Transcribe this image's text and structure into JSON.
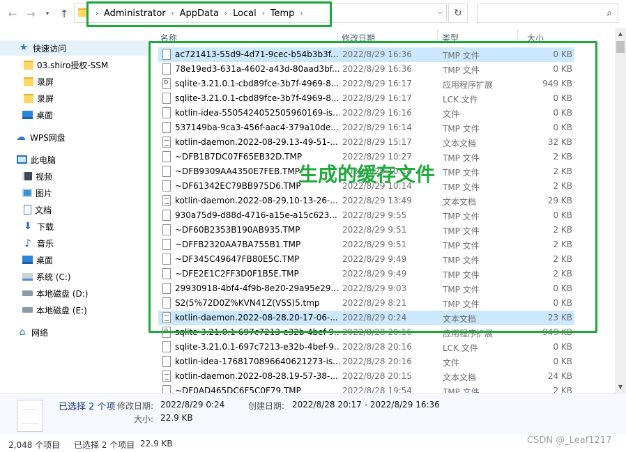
{
  "address": {
    "crumbs": [
      "Administrator",
      "AppData",
      "Local",
      "Temp"
    ]
  },
  "nav": {
    "back_icon": "back-arrow-icon",
    "forward_icon": "forward-arrow-icon",
    "history_icon": "chevron-down-icon",
    "up_icon": "up-arrow-icon"
  },
  "sidebar": {
    "items": [
      {
        "label": "快速访问",
        "icon": "star-icon"
      },
      {
        "label": "03.shiro授权-SSM",
        "icon": "folder-icon"
      },
      {
        "label": "录屏",
        "icon": "folder-icon"
      },
      {
        "label": "录屏",
        "icon": "folder-icon"
      },
      {
        "label": "桌面",
        "icon": "desktop-icon"
      },
      {
        "label": "WPS网盘",
        "icon": "cloud-icon"
      },
      {
        "label": "此电脑",
        "icon": "computer-icon"
      },
      {
        "label": "视频",
        "icon": "video-icon"
      },
      {
        "label": "图片",
        "icon": "pictures-icon"
      },
      {
        "label": "文档",
        "icon": "document-icon"
      },
      {
        "label": "下载",
        "icon": "download-icon"
      },
      {
        "label": "音乐",
        "icon": "music-icon"
      },
      {
        "label": "桌面",
        "icon": "desktop-icon"
      },
      {
        "label": "系统 (C:)",
        "icon": "system-drive-icon"
      },
      {
        "label": "本地磁盘 (D:)",
        "icon": "drive-icon"
      },
      {
        "label": "本地磁盘 (E:)",
        "icon": "drive-icon"
      },
      {
        "label": "网络",
        "icon": "network-icon"
      }
    ]
  },
  "columns": {
    "name": "名称",
    "date": "修改日期",
    "type": "类型",
    "size": "大小"
  },
  "files": [
    {
      "name": "ac721413-55d9-4d71-9cec-b54b3b3f...",
      "date": "2022/8/29 16:36",
      "type": "TMP 文件",
      "size": "0 KB",
      "icon": "file",
      "selected": true
    },
    {
      "name": "78e19ed3-631a-4602-a43d-80aad3bf...",
      "date": "2022/8/29 16:36",
      "type": "TMP 文件",
      "size": "0 KB",
      "icon": "file"
    },
    {
      "name": "sqlite-3.21.0.1-cbd89fce-3b7f-4969-8...",
      "date": "2022/8/29 16:17",
      "type": "应用程序扩展",
      "size": "949 KB",
      "icon": "dll"
    },
    {
      "name": "sqlite-3.21.0.1-cbd89fce-3b7f-4969-8...",
      "date": "2022/8/29 16:17",
      "type": "LCK 文件",
      "size": "0 KB",
      "icon": "file"
    },
    {
      "name": "kotlin-idea-5505424052505960169-is...",
      "date": "2022/8/29 16:16",
      "type": "文件",
      "size": "0 KB",
      "icon": "file"
    },
    {
      "name": "537149ba-9ca3-456f-aac4-379a10de...",
      "date": "2022/8/29 16:14",
      "type": "TMP 文件",
      "size": "0 KB",
      "icon": "file"
    },
    {
      "name": "kotlin-daemon.2022-08-29.13-49-51-...",
      "date": "2022/8/29 15:17",
      "type": "文本文档",
      "size": "32 KB",
      "icon": "txt"
    },
    {
      "name": "~DFB1B7DC07F65EB32D.TMP",
      "date": "2022/8/29 10:27",
      "type": "TMP 文件",
      "size": "2 KB",
      "icon": "file"
    },
    {
      "name": "~DFB9309AA4350E7FEB.TMP",
      "date": "2022/8/29 10:14",
      "type": "TMP 文件",
      "size": "2 KB",
      "icon": "file"
    },
    {
      "name": "~DF61342EC79BB975D6.TMP",
      "date": "2022/8/29 10:14",
      "type": "TMP 文件",
      "size": "2 KB",
      "icon": "file"
    },
    {
      "name": "kotlin-daemon.2022-08-29.10-13-26-...",
      "date": "2022/8/29 13:49",
      "type": "文本文档",
      "size": "29 KB",
      "icon": "txt"
    },
    {
      "name": "930a75d9-d88d-4716-a15e-a15c623...",
      "date": "2022/8/29 9:55",
      "type": "TMP 文件",
      "size": "0 KB",
      "icon": "file"
    },
    {
      "name": "~DF60B2353B190AB935.TMP",
      "date": "2022/8/29 9:51",
      "type": "TMP 文件",
      "size": "2 KB",
      "icon": "file"
    },
    {
      "name": "~DFFB2320AA7BA755B1.TMP",
      "date": "2022/8/29 9:51",
      "type": "TMP 文件",
      "size": "2 KB",
      "icon": "file"
    },
    {
      "name": "~DF345C49647FB80E5C.TMP",
      "date": "2022/8/29 9:49",
      "type": "TMP 文件",
      "size": "2 KB",
      "icon": "file"
    },
    {
      "name": "~DFE2E1C2FF3D0F1B5E.TMP",
      "date": "2022/8/29 9:49",
      "type": "TMP 文件",
      "size": "2 KB",
      "icon": "file"
    },
    {
      "name": "29930918-4bf4-4f9b-8e20-29a95e29...",
      "date": "2022/8/29 9:03",
      "type": "TMP 文件",
      "size": "0 KB",
      "icon": "file"
    },
    {
      "name": "S2(5%72D0Z%KVN41Z(VSS)5.tmp",
      "date": "2022/8/29 8:21",
      "type": "TMP 文件",
      "size": "0 KB",
      "icon": "file"
    },
    {
      "name": "kotlin-daemon.2022-08-28.20-17-06-...",
      "date": "2022/8/29 0:24",
      "type": "文本文档",
      "size": "23 KB",
      "icon": "txt",
      "selected": true
    },
    {
      "name": "sqlite-3.21.0.1-697c7213-e32b-4bef-9...",
      "date": "2022/8/28 20:16",
      "type": "应用程序扩展",
      "size": "949 KB",
      "icon": "dll"
    },
    {
      "name": "sqlite-3.21.0.1-697c7213-e32b-4bef-9...",
      "date": "2022/8/28 20:16",
      "type": "LCK 文件",
      "size": "0 KB",
      "icon": "file"
    },
    {
      "name": "kotlin-idea-1768170896640621273-is...",
      "date": "2022/8/28 20:16",
      "type": "文件",
      "size": "0 KB",
      "icon": "file"
    },
    {
      "name": "kotlin-daemon.2022-08-28.19-57-38-...",
      "date": "2022/8/28 20:15",
      "type": "文本文档",
      "size": "24 KB",
      "icon": "txt"
    },
    {
      "name": "~DF0AD465DC6F5C0F79.TMP",
      "date": "2022/8/28 19:54",
      "type": "TMP 文件",
      "size": "2 KB",
      "icon": "file"
    }
  ],
  "annotation": {
    "text": "生成的缓存文件",
    "color": "#1faa3c"
  },
  "details": {
    "selected": "已选择 2 个项",
    "modified_label": "修改日期:",
    "modified_value": "2022/8/29 0:24",
    "created_label": "创建日期:",
    "created_value": "2022/8/28 20:17 - 2022/8/29 16:36",
    "size_label": "大小:",
    "size_value": "22.9 KB"
  },
  "status": {
    "count": "2,048 个项目",
    "selected": "已选择 2 个项目",
    "size": "22.9 KB"
  },
  "watermark": "CSDN @_Leaf1217"
}
